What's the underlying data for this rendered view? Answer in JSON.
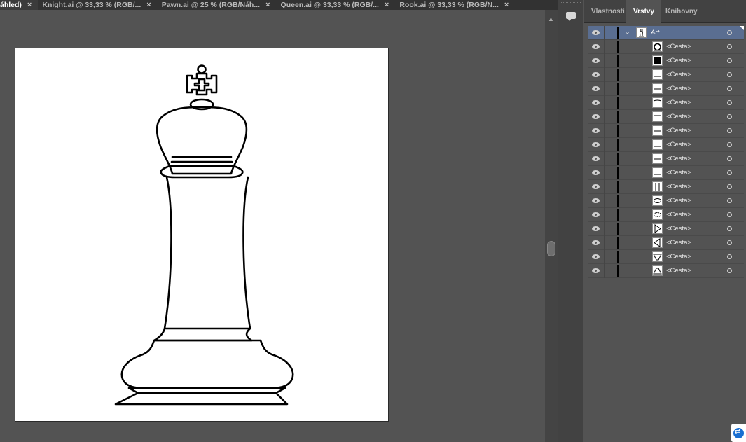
{
  "tabs": [
    {
      "label": "áhled)",
      "active": true
    },
    {
      "label": "Knight.ai @ 33,33 % (RGB/...",
      "active": false
    },
    {
      "label": "Pawn.ai @ 25 % (RGB/Náh...",
      "active": false
    },
    {
      "label": "Queen.ai @ 33,33 % (RGB/...",
      "active": false
    },
    {
      "label": "Rook.ai @ 33,33 % (RGB/N...",
      "active": false
    }
  ],
  "tab_close_glyph": "×",
  "panel": {
    "tabs": [
      "Vlastnosti",
      "Vrstvy",
      "Knihovny"
    ],
    "active_tab": "Vrstvy",
    "layer": {
      "name": "Art",
      "expanded": true
    },
    "paths": [
      {
        "name": "<Cesta>",
        "thumb": "ring"
      },
      {
        "name": "<Cesta>",
        "thumb": "square"
      },
      {
        "name": "<Cesta>",
        "thumb": "hline-low"
      },
      {
        "name": "<Cesta>",
        "thumb": "hline-mid"
      },
      {
        "name": "<Cesta>",
        "thumb": "arc"
      },
      {
        "name": "<Cesta>",
        "thumb": "hline-top"
      },
      {
        "name": "<Cesta>",
        "thumb": "hline-mid"
      },
      {
        "name": "<Cesta>",
        "thumb": "hline-low"
      },
      {
        "name": "<Cesta>",
        "thumb": "hline-mid"
      },
      {
        "name": "<Cesta>",
        "thumb": "hline-low"
      },
      {
        "name": "<Cesta>",
        "thumb": "vlines"
      },
      {
        "name": "<Cesta>",
        "thumb": "ellipse"
      },
      {
        "name": "<Cesta>",
        "thumb": "ellipse-dash"
      },
      {
        "name": "<Cesta>",
        "thumb": "tri-right"
      },
      {
        "name": "<Cesta>",
        "thumb": "tri-left"
      },
      {
        "name": "<Cesta>",
        "thumb": "trap-down"
      },
      {
        "name": "<Cesta>",
        "thumb": "trap-up"
      }
    ]
  },
  "icons": {
    "visibility": "eye-icon",
    "target": "target-circle-icon",
    "expand": "chevron-down-icon",
    "comments": "comment-icon",
    "panel_menu": "hamburger-menu-icon",
    "teamviewer": "teamviewer-icon"
  },
  "colors": {
    "selection": "#5a6e91",
    "layer_color": "#000000",
    "canvas": "#535353",
    "artboard": "#ffffff"
  }
}
